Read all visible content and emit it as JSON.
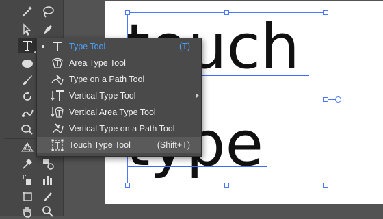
{
  "canvas": {
    "line1": "touch",
    "line2": "type",
    "text_color": "#111111",
    "selection_color": "#4a78ff"
  },
  "toolbar": {
    "tools": [
      {
        "name": "magic-wand-icon"
      },
      {
        "name": "lasso-icon"
      },
      {
        "name": "direct-selection-icon"
      },
      {
        "name": "pen-icon"
      },
      {
        "name": "type-icon",
        "active": true
      },
      {
        "name": "line-segment-icon"
      },
      {
        "name": "ellipse-icon"
      },
      {
        "name": "paintbrush-icon"
      },
      {
        "name": "rotate-icon"
      },
      {
        "name": "scale-icon"
      },
      {
        "name": "puppet-warp-icon"
      },
      {
        "name": "free-transform-icon"
      },
      {
        "name": "shape-builder-icon"
      },
      {
        "name": "perspective-grid-icon"
      },
      {
        "name": "mesh-icon"
      },
      {
        "name": "gradient-icon"
      },
      {
        "name": "eyedropper-icon"
      },
      {
        "name": "blend-icon"
      },
      {
        "name": "symbol-sprayer-icon"
      },
      {
        "name": "column-graph-icon"
      },
      {
        "name": "artboard-icon"
      },
      {
        "name": "slice-icon"
      },
      {
        "name": "hand-icon"
      },
      {
        "name": "zoom-icon"
      }
    ]
  },
  "flyout": {
    "items": [
      {
        "label": "Type Tool",
        "shortcut": "(T)",
        "icon": "type-tool-icon",
        "selected": true
      },
      {
        "label": "Area Type Tool",
        "shortcut": "",
        "icon": "area-type-tool-icon"
      },
      {
        "label": "Type on a Path Tool",
        "shortcut": "",
        "icon": "type-on-path-tool-icon"
      },
      {
        "label": "Vertical Type Tool",
        "shortcut": "",
        "icon": "vertical-type-tool-icon"
      },
      {
        "label": "Vertical Area Type Tool",
        "shortcut": "",
        "icon": "vertical-area-type-tool-icon"
      },
      {
        "label": "Vertical Type on a Path Tool",
        "shortcut": "",
        "icon": "vertical-type-on-path-tool-icon"
      },
      {
        "label": "Touch Type Tool",
        "shortcut": "(Shift+T)",
        "icon": "touch-type-tool-icon",
        "highlighted": true
      }
    ]
  }
}
